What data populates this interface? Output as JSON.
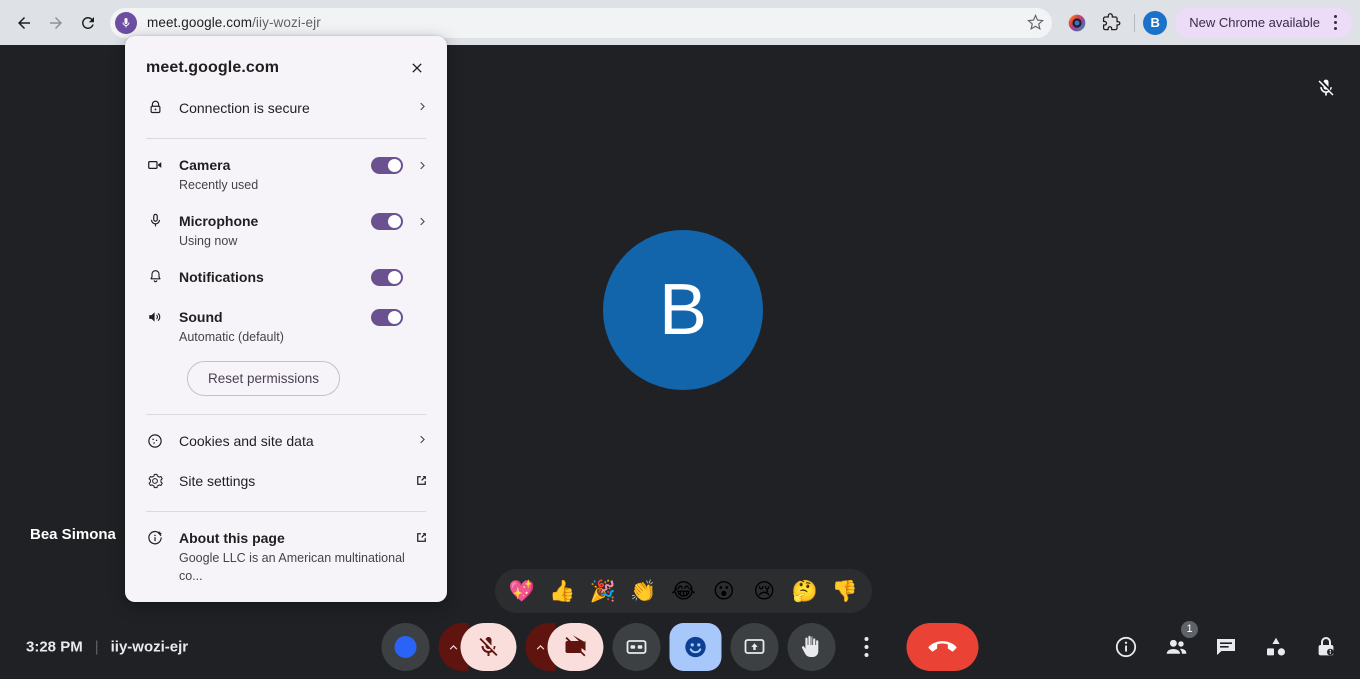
{
  "browser": {
    "back_label": "Back",
    "forward_label": "Forward",
    "reload_label": "Reload",
    "url_domain": "meet.google.com",
    "url_path": "/iiy-wozi-ejr",
    "site_chip_icon": "microphone-icon",
    "bookmark_icon": "star-icon",
    "extension_icon": "puzzle-piece-icon",
    "profile_initial": "B",
    "update_pill_label": "New Chrome available",
    "menu_icon": "three-dot-menu-icon"
  },
  "popup": {
    "title": "meet.google.com",
    "close_icon": "close-icon",
    "connection": {
      "icon": "lock-icon",
      "label": "Connection is secure"
    },
    "permissions": [
      {
        "icon": "camera-icon",
        "label": "Camera",
        "sub": "Recently used",
        "toggle": true,
        "chevron": true
      },
      {
        "icon": "microphone-icon",
        "label": "Microphone",
        "sub": "Using now",
        "toggle": true,
        "chevron": true
      },
      {
        "icon": "bell-icon",
        "label": "Notifications",
        "sub": "",
        "toggle": true,
        "chevron": false
      },
      {
        "icon": "speaker-icon",
        "label": "Sound",
        "sub": "Automatic (default)",
        "toggle": true,
        "chevron": false
      }
    ],
    "reset_label": "Reset permissions",
    "links": [
      {
        "icon": "cookie-icon",
        "label": "Cookies and site data",
        "trailing": "chevron"
      },
      {
        "icon": "gear-icon",
        "label": "Site settings",
        "trailing": "external-link"
      }
    ],
    "about": {
      "icon": "info-plus-icon",
      "label": "About this page",
      "sub": "Google LLC is an American multinational co...",
      "trailing": "external-link"
    }
  },
  "meet": {
    "participant_initial": "B",
    "participant_name": "Bea Simona",
    "muted_icon": "mic-off-icon",
    "time": "3:28 PM",
    "divider": "|",
    "meeting_code": "iiy-wozi-ejr",
    "reactions": [
      "💖",
      "👍",
      "🎉",
      "👏",
      "😂",
      "😮",
      "😢",
      "🤔",
      "👎"
    ],
    "controls": {
      "effects_label": "Apply visual effects",
      "mic_label": "Turn on microphone",
      "mic_state": "off",
      "camera_label": "Turn on camera",
      "camera_state": "off",
      "captions_label": "Turn on captions",
      "emoji_label": "Send a reaction",
      "present_label": "Present now",
      "hand_label": "Raise hand",
      "more_label": "More options",
      "endcall_label": "Leave call"
    },
    "right_controls": [
      {
        "icon": "info-icon",
        "label": "Meeting details",
        "badge": ""
      },
      {
        "icon": "people-icon",
        "label": "People",
        "badge": "1"
      },
      {
        "icon": "chat-icon",
        "label": "Chat with everyone",
        "badge": ""
      },
      {
        "icon": "activities-icon",
        "label": "Activities",
        "badge": ""
      },
      {
        "icon": "host-controls-icon",
        "label": "Host controls",
        "badge": ""
      }
    ]
  },
  "colors": {
    "toolbar_bg": "#dee1e6",
    "stage_bg": "#202124",
    "popup_bg": "#f7f4f9",
    "toggle_on": "#6a5291",
    "avatar_blue": "#1265ab",
    "endcall_red": "#ea4335",
    "danger_dark": "#601410",
    "danger_light": "#f9dedc",
    "emoji_active": "#a8c7fa",
    "update_pill": "#ecdcf7"
  }
}
